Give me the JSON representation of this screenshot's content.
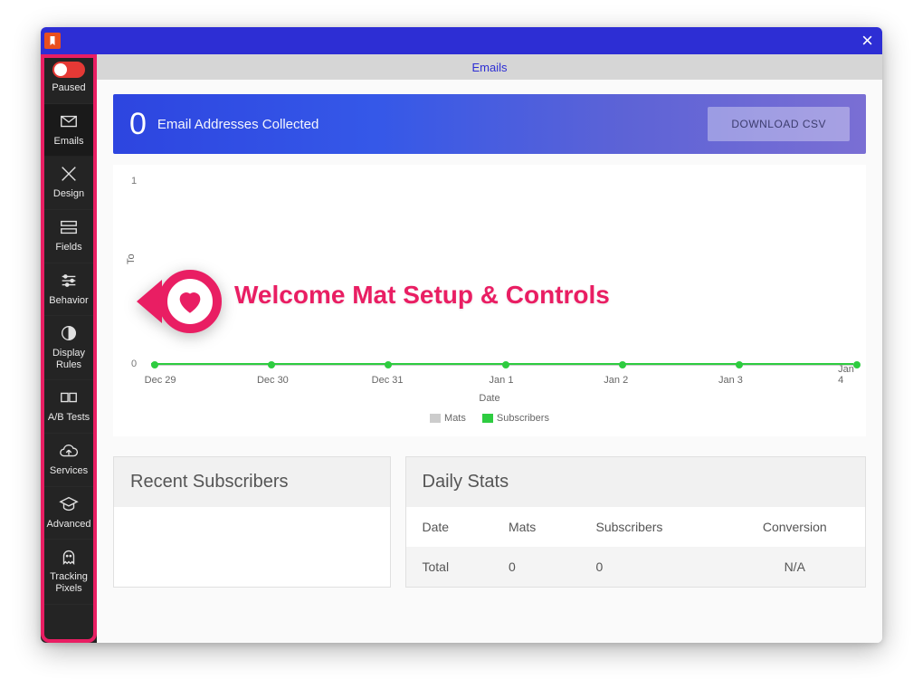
{
  "window": {
    "tab_label": "Emails"
  },
  "sidebar": {
    "status_label": "Paused",
    "items": [
      {
        "key": "emails",
        "label": "Emails"
      },
      {
        "key": "design",
        "label": "Design"
      },
      {
        "key": "fields",
        "label": "Fields"
      },
      {
        "key": "behavior",
        "label": "Behavior"
      },
      {
        "key": "display",
        "label": "Display Rules"
      },
      {
        "key": "ab",
        "label": "A/B Tests"
      },
      {
        "key": "services",
        "label": "Services"
      },
      {
        "key": "advanced",
        "label": "Advanced"
      },
      {
        "key": "tracking",
        "label": "Tracking Pixels"
      }
    ]
  },
  "hero": {
    "count": "0",
    "label": "Email Addresses Collected",
    "download_label": "DOWNLOAD CSV"
  },
  "chart_data": {
    "type": "line",
    "categories": [
      "Dec 29",
      "Dec 30",
      "Dec 31",
      "Jan 1",
      "Jan 2",
      "Jan 3",
      "Jan 4"
    ],
    "series": [
      {
        "name": "Mats",
        "values": [
          0,
          0,
          0,
          0,
          0,
          0,
          0
        ],
        "color": "#cccccc"
      },
      {
        "name": "Subscribers",
        "values": [
          0,
          0,
          0,
          0,
          0,
          0,
          0
        ],
        "color": "#2ecc40"
      }
    ],
    "xlabel": "Date",
    "ylabel": "To",
    "ylim": [
      0,
      1
    ],
    "yticks": [
      0,
      1
    ],
    "legend": [
      "Mats",
      "Subscribers"
    ]
  },
  "panels": {
    "recent_title": "Recent Subscribers",
    "stats_title": "Daily Stats",
    "stats_columns": [
      "Date",
      "Mats",
      "Subscribers",
      "Conversion"
    ],
    "stats_rows": [
      {
        "label": "Total",
        "mats": "0",
        "subscribers": "0",
        "conversion": "N/A"
      }
    ]
  },
  "callout": {
    "text": "Welcome Mat Setup & Controls"
  },
  "colors": {
    "accent_blue": "#2d2ed4",
    "sidebar_bg": "#242424",
    "highlight_pink": "#e91e63",
    "chart_green": "#2ecc40"
  }
}
